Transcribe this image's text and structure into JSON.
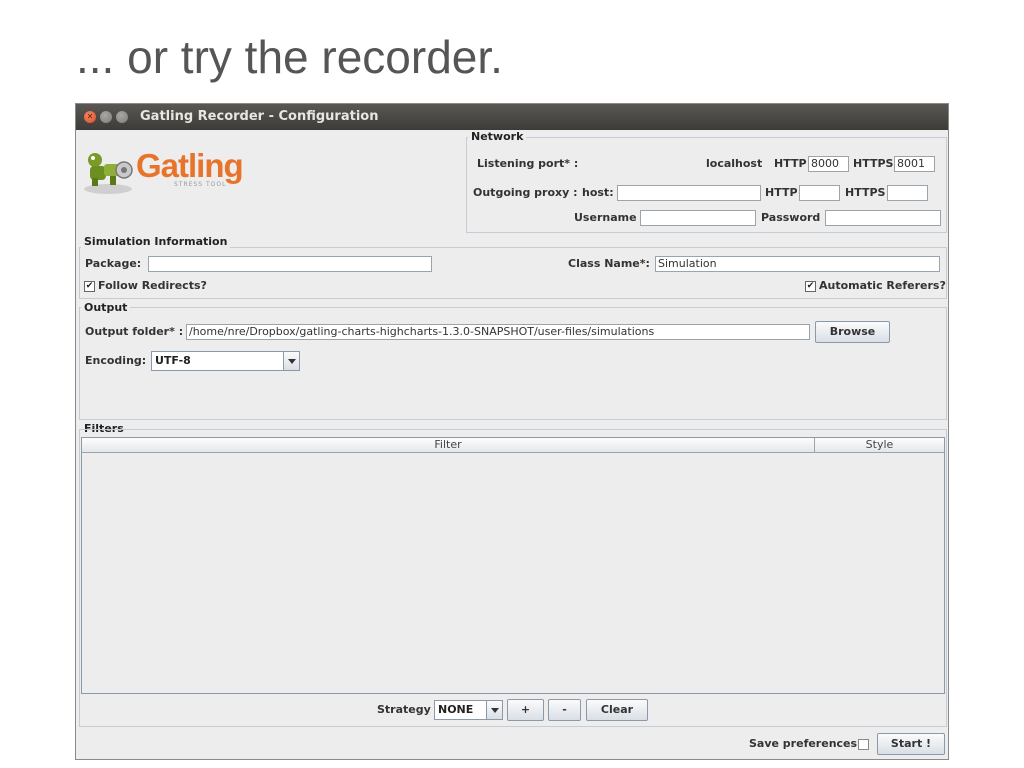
{
  "slide": {
    "title": "... or try the recorder."
  },
  "window": {
    "title": "Gatling Recorder - Configuration",
    "logo_text": "Gatling",
    "logo_subtext": "STRESS TOOL"
  },
  "network": {
    "group_label": "Network",
    "listening_port_label": "Listening port* :",
    "localhost_label": "localhost",
    "http_label": "HTTP",
    "http_port": "8000",
    "https_label": "HTTPS",
    "https_port": "8001",
    "outgoing_proxy_label": "Outgoing proxy :",
    "host_label": "host:",
    "host_value": "",
    "proxy_http_label": "HTTP",
    "proxy_http_value": "",
    "proxy_https_label": "HTTPS",
    "proxy_https_value": "",
    "username_label": "Username",
    "username_value": "",
    "password_label": "Password",
    "password_value": ""
  },
  "simulation": {
    "group_label": "Simulation Information",
    "package_label": "Package:",
    "package_value": "",
    "class_name_label": "Class Name*:",
    "class_name_value": "Simulation",
    "follow_redirects_label": "Follow Redirects?",
    "follow_redirects_checked": true,
    "automatic_referers_label": "Automatic Referers?",
    "automatic_referers_checked": true
  },
  "output": {
    "group_label": "Output",
    "folder_label": "Output folder* :",
    "folder_value": "/home/nre/Dropbox/gatling-charts-highcharts-1.3.0-SNAPSHOT/user-files/simulations",
    "browse_label": "Browse",
    "encoding_label": "Encoding:",
    "encoding_value": "UTF-8"
  },
  "filters": {
    "group_label": "Filters",
    "columns": [
      "Filter",
      "Style"
    ],
    "rows": [],
    "strategy_label": "Strategy",
    "strategy_value": "NONE",
    "add_label": "+",
    "remove_label": "-",
    "clear_label": "Clear"
  },
  "footer": {
    "save_preferences_label": "Save preferences",
    "save_preferences_checked": false,
    "start_label": "Start !"
  }
}
